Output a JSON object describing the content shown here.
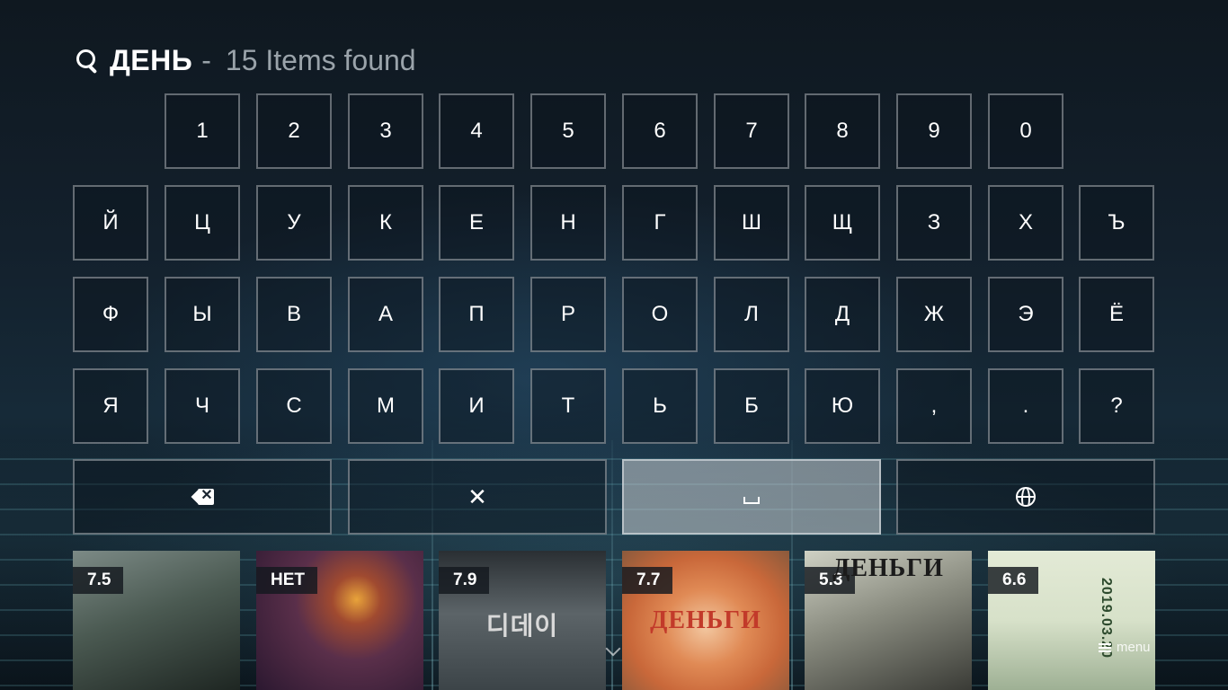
{
  "header": {
    "query": "ДЕНЬ",
    "separator": "-",
    "result_count": "15 Items found"
  },
  "keyboard": {
    "row_numbers": [
      "1",
      "2",
      "3",
      "4",
      "5",
      "6",
      "7",
      "8",
      "9",
      "0"
    ],
    "row_1": [
      "Й",
      "Ц",
      "У",
      "К",
      "Е",
      "Н",
      "Г",
      "Ш",
      "Щ",
      "З",
      "Х",
      "Ъ"
    ],
    "row_2": [
      "Ф",
      "Ы",
      "В",
      "А",
      "П",
      "Р",
      "О",
      "Л",
      "Д",
      "Ж",
      "Э",
      "Ё"
    ],
    "row_3": [
      "Я",
      "Ч",
      "С",
      "М",
      "И",
      "Т",
      "Ь",
      "Б",
      "Ю",
      ",",
      ".",
      "?"
    ],
    "actions": {
      "backspace_icon": "backspace-icon",
      "clear_glyph": "✕",
      "space_icon": "space-icon",
      "language_icon": "globe-icon"
    }
  },
  "results": [
    {
      "rating": "7.5",
      "accent": "#4b5a52"
    },
    {
      "rating": "НЕТ",
      "accent": "#5a2f4a"
    },
    {
      "rating": "7.9",
      "accent": "#3c4448",
      "title_text": "디데이"
    },
    {
      "rating": "7.7",
      "accent": "#c9683a",
      "title_text": "ДЕНЬГИ"
    },
    {
      "rating": "5.3",
      "accent": "#8a8c80",
      "title_text": "ДЕНЬГИ"
    },
    {
      "rating": "6.6",
      "accent": "#d7e1c9",
      "title_text": "2019.03.20"
    }
  ],
  "footer": {
    "menu_label": "menu",
    "menu_icon": "hamburger-icon",
    "scroll_icon": "chevron-down-icon"
  }
}
